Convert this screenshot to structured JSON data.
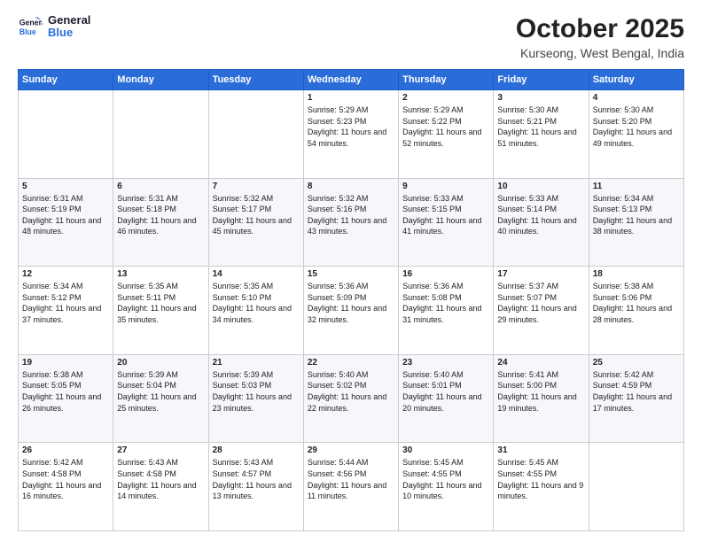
{
  "logo": {
    "line1": "General",
    "line2": "Blue"
  },
  "title": "October 2025",
  "subtitle": "Kurseong, West Bengal, India",
  "header_days": [
    "Sunday",
    "Monday",
    "Tuesday",
    "Wednesday",
    "Thursday",
    "Friday",
    "Saturday"
  ],
  "weeks": [
    [
      {
        "day": "",
        "sunrise": "",
        "sunset": "",
        "daylight": ""
      },
      {
        "day": "",
        "sunrise": "",
        "sunset": "",
        "daylight": ""
      },
      {
        "day": "",
        "sunrise": "",
        "sunset": "",
        "daylight": ""
      },
      {
        "day": "1",
        "sunrise": "Sunrise: 5:29 AM",
        "sunset": "Sunset: 5:23 PM",
        "daylight": "Daylight: 11 hours and 54 minutes."
      },
      {
        "day": "2",
        "sunrise": "Sunrise: 5:29 AM",
        "sunset": "Sunset: 5:22 PM",
        "daylight": "Daylight: 11 hours and 52 minutes."
      },
      {
        "day": "3",
        "sunrise": "Sunrise: 5:30 AM",
        "sunset": "Sunset: 5:21 PM",
        "daylight": "Daylight: 11 hours and 51 minutes."
      },
      {
        "day": "4",
        "sunrise": "Sunrise: 5:30 AM",
        "sunset": "Sunset: 5:20 PM",
        "daylight": "Daylight: 11 hours and 49 minutes."
      }
    ],
    [
      {
        "day": "5",
        "sunrise": "Sunrise: 5:31 AM",
        "sunset": "Sunset: 5:19 PM",
        "daylight": "Daylight: 11 hours and 48 minutes."
      },
      {
        "day": "6",
        "sunrise": "Sunrise: 5:31 AM",
        "sunset": "Sunset: 5:18 PM",
        "daylight": "Daylight: 11 hours and 46 minutes."
      },
      {
        "day": "7",
        "sunrise": "Sunrise: 5:32 AM",
        "sunset": "Sunset: 5:17 PM",
        "daylight": "Daylight: 11 hours and 45 minutes."
      },
      {
        "day": "8",
        "sunrise": "Sunrise: 5:32 AM",
        "sunset": "Sunset: 5:16 PM",
        "daylight": "Daylight: 11 hours and 43 minutes."
      },
      {
        "day": "9",
        "sunrise": "Sunrise: 5:33 AM",
        "sunset": "Sunset: 5:15 PM",
        "daylight": "Daylight: 11 hours and 41 minutes."
      },
      {
        "day": "10",
        "sunrise": "Sunrise: 5:33 AM",
        "sunset": "Sunset: 5:14 PM",
        "daylight": "Daylight: 11 hours and 40 minutes."
      },
      {
        "day": "11",
        "sunrise": "Sunrise: 5:34 AM",
        "sunset": "Sunset: 5:13 PM",
        "daylight": "Daylight: 11 hours and 38 minutes."
      }
    ],
    [
      {
        "day": "12",
        "sunrise": "Sunrise: 5:34 AM",
        "sunset": "Sunset: 5:12 PM",
        "daylight": "Daylight: 11 hours and 37 minutes."
      },
      {
        "day": "13",
        "sunrise": "Sunrise: 5:35 AM",
        "sunset": "Sunset: 5:11 PM",
        "daylight": "Daylight: 11 hours and 35 minutes."
      },
      {
        "day": "14",
        "sunrise": "Sunrise: 5:35 AM",
        "sunset": "Sunset: 5:10 PM",
        "daylight": "Daylight: 11 hours and 34 minutes."
      },
      {
        "day": "15",
        "sunrise": "Sunrise: 5:36 AM",
        "sunset": "Sunset: 5:09 PM",
        "daylight": "Daylight: 11 hours and 32 minutes."
      },
      {
        "day": "16",
        "sunrise": "Sunrise: 5:36 AM",
        "sunset": "Sunset: 5:08 PM",
        "daylight": "Daylight: 11 hours and 31 minutes."
      },
      {
        "day": "17",
        "sunrise": "Sunrise: 5:37 AM",
        "sunset": "Sunset: 5:07 PM",
        "daylight": "Daylight: 11 hours and 29 minutes."
      },
      {
        "day": "18",
        "sunrise": "Sunrise: 5:38 AM",
        "sunset": "Sunset: 5:06 PM",
        "daylight": "Daylight: 11 hours and 28 minutes."
      }
    ],
    [
      {
        "day": "19",
        "sunrise": "Sunrise: 5:38 AM",
        "sunset": "Sunset: 5:05 PM",
        "daylight": "Daylight: 11 hours and 26 minutes."
      },
      {
        "day": "20",
        "sunrise": "Sunrise: 5:39 AM",
        "sunset": "Sunset: 5:04 PM",
        "daylight": "Daylight: 11 hours and 25 minutes."
      },
      {
        "day": "21",
        "sunrise": "Sunrise: 5:39 AM",
        "sunset": "Sunset: 5:03 PM",
        "daylight": "Daylight: 11 hours and 23 minutes."
      },
      {
        "day": "22",
        "sunrise": "Sunrise: 5:40 AM",
        "sunset": "Sunset: 5:02 PM",
        "daylight": "Daylight: 11 hours and 22 minutes."
      },
      {
        "day": "23",
        "sunrise": "Sunrise: 5:40 AM",
        "sunset": "Sunset: 5:01 PM",
        "daylight": "Daylight: 11 hours and 20 minutes."
      },
      {
        "day": "24",
        "sunrise": "Sunrise: 5:41 AM",
        "sunset": "Sunset: 5:00 PM",
        "daylight": "Daylight: 11 hours and 19 minutes."
      },
      {
        "day": "25",
        "sunrise": "Sunrise: 5:42 AM",
        "sunset": "Sunset: 4:59 PM",
        "daylight": "Daylight: 11 hours and 17 minutes."
      }
    ],
    [
      {
        "day": "26",
        "sunrise": "Sunrise: 5:42 AM",
        "sunset": "Sunset: 4:58 PM",
        "daylight": "Daylight: 11 hours and 16 minutes."
      },
      {
        "day": "27",
        "sunrise": "Sunrise: 5:43 AM",
        "sunset": "Sunset: 4:58 PM",
        "daylight": "Daylight: 11 hours and 14 minutes."
      },
      {
        "day": "28",
        "sunrise": "Sunrise: 5:43 AM",
        "sunset": "Sunset: 4:57 PM",
        "daylight": "Daylight: 11 hours and 13 minutes."
      },
      {
        "day": "29",
        "sunrise": "Sunrise: 5:44 AM",
        "sunset": "Sunset: 4:56 PM",
        "daylight": "Daylight: 11 hours and 11 minutes."
      },
      {
        "day": "30",
        "sunrise": "Sunrise: 5:45 AM",
        "sunset": "Sunset: 4:55 PM",
        "daylight": "Daylight: 11 hours and 10 minutes."
      },
      {
        "day": "31",
        "sunrise": "Sunrise: 5:45 AM",
        "sunset": "Sunset: 4:55 PM",
        "daylight": "Daylight: 11 hours and 9 minutes."
      },
      {
        "day": "",
        "sunrise": "",
        "sunset": "",
        "daylight": ""
      }
    ]
  ]
}
